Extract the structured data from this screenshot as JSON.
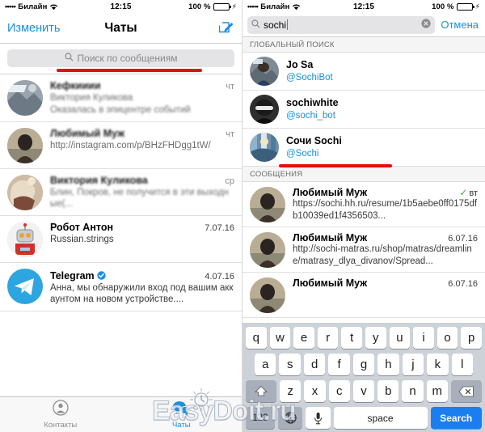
{
  "colors": {
    "accent": "#1a8fe3",
    "keyboard_bg": "#cdd1d8",
    "search_key_blue": "#1a7ef0",
    "annotation_red": "#e01010",
    "battery_green": "#45d355",
    "verified_blue": "#1a8fe3",
    "check_green": "#35b54a"
  },
  "status_bar": {
    "signal_dots": "•••••",
    "carrier": "Билайн",
    "wifi_icon": "wifi-icon",
    "time": "12:15",
    "battery_percent": "100 %",
    "battery_level": 100,
    "charging_icon": "lightning-bolt-icon"
  },
  "left_panel": {
    "nav": {
      "edit_label": "Изменить",
      "title": "Чаты",
      "compose_icon": "compose-pencil-icon"
    },
    "search": {
      "placeholder": "Поиск по сообщениям",
      "icon": "search-icon"
    },
    "chats": [
      {
        "name": "Кефкииии",
        "name_blurred": true,
        "date": "чт",
        "preview_blurred": "Виктория Куликова",
        "preview": "Оказалась в эпицентре событий",
        "avatar_icon": "photo-avatar-icon"
      },
      {
        "name": "Любимый Муж",
        "name_blurred": true,
        "date": "чт",
        "preview": "http://instagram.com/p/BHzFHDgg1tW/",
        "avatar_icon": "person-avatar-icon"
      },
      {
        "name": "Виктория Куликова",
        "name_blurred": true,
        "date": "ср",
        "preview": "Блин, Покров, не получится в эти выходные(...",
        "avatar_icon": "person-avatar-icon"
      },
      {
        "name": "Робот Антон",
        "name_blurred": false,
        "date": "7.07.16",
        "preview": "Russian.strings",
        "avatar_icon": "robot-avatar-icon"
      },
      {
        "name": "Telegram",
        "name_blurred": false,
        "verified": true,
        "date": "4.07.16",
        "preview": "Анна, мы обнаружили вход под вашим аккаунтом на новом устройстве....",
        "avatar_icon": "telegram-paperplane-icon"
      }
    ],
    "tabs": [
      {
        "label": "Контакты",
        "icon": "contacts-person-icon",
        "active": false
      },
      {
        "label": "Чаты",
        "icon": "chats-bubbles-icon",
        "active": true
      }
    ]
  },
  "right_panel": {
    "search": {
      "value": "sochi",
      "icon": "search-icon",
      "clear_icon": "clear-circle-x-icon",
      "cancel_label": "Отмена"
    },
    "global_section_header": "ГЛОБАЛЬНЫЙ ПОИСК",
    "global_results": [
      {
        "name": "Jo Sa",
        "handle": "@SochiBot",
        "avatar_icon": "photo-avatar-icon"
      },
      {
        "name": "sochiwhite",
        "handle": "@sochi_bot",
        "avatar_icon": "photo-avatar-icon"
      },
      {
        "name": "Сочи Sochi",
        "handle": "@Sochi",
        "avatar_icon": "photo-avatar-icon"
      }
    ],
    "messages_section_header": "СООБЩЕНИЯ",
    "messages": [
      {
        "name": "Любимый Муж",
        "date": "вт",
        "has_check": true,
        "check_icon": "check-mark-icon",
        "text": "https://sochi.hh.ru/resume/1b5aebe0ff0175dfb10039ed1f4356503...",
        "avatar_icon": "person-avatar-icon"
      },
      {
        "name": "Любимый Муж",
        "date": "6.07.16",
        "has_check": false,
        "text": "http://sochi-matras.ru/shop/matras/dreamline/matrasy_dlya_divanov/Spread...",
        "avatar_icon": "person-avatar-icon"
      },
      {
        "name": "Любимый Муж",
        "date": "6.07.16",
        "has_check": false,
        "text": "",
        "avatar_icon": "person-avatar-icon"
      }
    ],
    "keyboard": {
      "row1": [
        "q",
        "w",
        "e",
        "r",
        "t",
        "y",
        "u",
        "i",
        "o",
        "p"
      ],
      "row2": [
        "a",
        "s",
        "d",
        "f",
        "g",
        "h",
        "j",
        "k",
        "l"
      ],
      "row3_letters": [
        "z",
        "x",
        "c",
        "v",
        "b",
        "n",
        "m"
      ],
      "shift_icon": "shift-arrow-icon",
      "backspace_icon": "backspace-delete-icon",
      "numbers_label": "123",
      "globe_icon": "globe-language-icon",
      "mic_icon": "microphone-icon",
      "space_label": "space",
      "search_label": "Search"
    }
  },
  "annotations": {
    "underline_1_target": "Поиск по сообщениям",
    "underline_2_target": "@Sochi"
  },
  "watermark": {
    "text": "EasyDoit.ru",
    "icon": "sun-clock-icon"
  }
}
